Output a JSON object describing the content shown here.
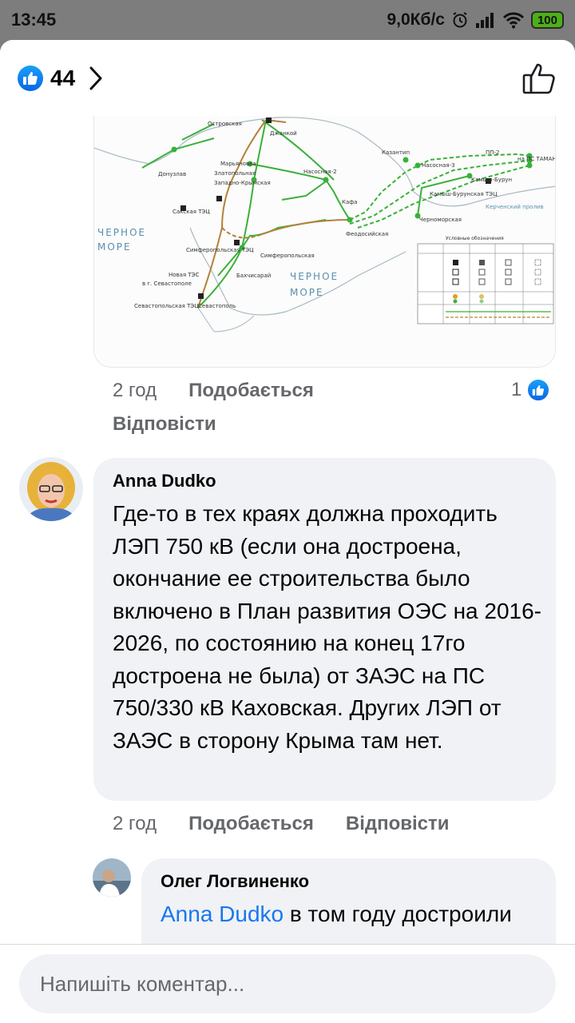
{
  "status_bar": {
    "time": "13:45",
    "net_speed": "9,0Кб/с",
    "battery": "100"
  },
  "header": {
    "reaction_count": "44",
    "icons": [
      "like-icon",
      "chevron-right-icon",
      "thumbs-up-outline-icon"
    ]
  },
  "map": {
    "labels": {
      "ostrovskaya": "Островская",
      "dzhankoy": "Джанкой",
      "maryanovka": "Марьяновка",
      "zlatopolnaya": "Злато­польная",
      "zapadno_krymskaya": "Западно-Крымская",
      "nasosnaya2": "Насосная-2",
      "kazantip": "Казантип",
      "nasosnaya3": "Насосная-3",
      "pp2": "ПП-2",
      "taman": "на ПС ТАМАНЬ",
      "kamysh_burun": "Камыш-Бурун",
      "kamysh_tec": "Камыш-Бурунская ТЭЦ",
      "strait": "Керченский пролив",
      "kafa": "Кафа",
      "feodosiya": "Феодосийская",
      "chernomorskaya": "Черноморская",
      "sakskaya": "Сакская ТЭЦ",
      "simferopol_tec": "Симферопольская ТЭЦ",
      "simferopolskaya": "Симферопольская",
      "bakhchisaray": "Бахчисарай",
      "novaya_tes": "Новая ТЭС",
      "sevastopol_g": "в г. Севастополе",
      "sevastopol_tec": "Севастопольская ТЭЦ",
      "sevastopol": "Севастополь",
      "donuzlav": "Донузлав",
      "black_sea_1a": "ЧЕРНОЕ",
      "black_sea_1b": "МОРЕ",
      "black_sea_2a": "ЧЕРНОЕ",
      "black_sea_2b": "МОРЕ",
      "legend_title": "Условные обозначения"
    }
  },
  "first_comment_meta": {
    "time": "2 год",
    "like_label": "Подобається",
    "reply_label": "Відповісти",
    "like_count": "1"
  },
  "comment_anna": {
    "author": "Anna Dudko",
    "text": "Где-то в тех краях должна проходить ЛЭП 750 кВ (если она достроена, окончание ее строительства было включено в План развития ОЭС на 2016-2026, по состоянию на конец 17го достроена не была) от ЗАЭС на ПС 750/330 кВ Каховская. Других ЛЭП от ЗАЭС в сторону Крыма там нет.",
    "time": "2 год",
    "like_label": "Подобається",
    "reply_label": "Відповісти"
  },
  "comment_oleg": {
    "author": "Олег Логвиненко",
    "mention": "Anna Dudko",
    "text": " в том году достроили"
  },
  "composer": {
    "placeholder": "Напишіть коментар..."
  }
}
